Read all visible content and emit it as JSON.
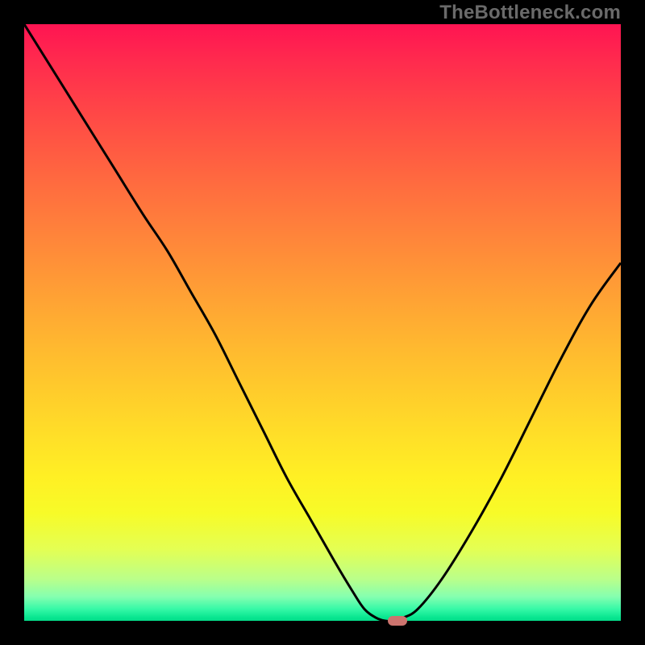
{
  "watermark": "TheBottleneck.com",
  "colors": {
    "frame": "#000000",
    "curve": "#000000",
    "marker": "#cc746e",
    "gradient_top": "#ff1452",
    "gradient_bottom": "#05dc89"
  },
  "chart_data": {
    "type": "line",
    "title": "",
    "xlabel": "",
    "ylabel": "",
    "xlim": [
      0,
      100
    ],
    "ylim": [
      0,
      100
    ],
    "x": [
      0,
      5,
      10,
      15,
      20,
      24,
      28,
      32,
      36,
      40,
      44,
      48,
      52,
      55,
      57,
      59,
      60.5,
      62,
      63.5,
      66,
      70,
      75,
      80,
      85,
      90,
      95,
      100
    ],
    "values": [
      100,
      92,
      84,
      76,
      68,
      62,
      55,
      48,
      40,
      32,
      24,
      17,
      10,
      5,
      2,
      0.5,
      0,
      0,
      0.5,
      2,
      7,
      15,
      24,
      34,
      44,
      53,
      60
    ],
    "marker": {
      "x": 62.5,
      "y": 0
    },
    "gradient_stops": [
      {
        "p": 0,
        "c": "#ff1452"
      },
      {
        "p": 6,
        "c": "#ff2a4e"
      },
      {
        "p": 13,
        "c": "#ff4148"
      },
      {
        "p": 20,
        "c": "#ff5743"
      },
      {
        "p": 27,
        "c": "#ff6c3f"
      },
      {
        "p": 34,
        "c": "#ff803b"
      },
      {
        "p": 41,
        "c": "#ff9437"
      },
      {
        "p": 48,
        "c": "#ffa833"
      },
      {
        "p": 55,
        "c": "#ffbb2f"
      },
      {
        "p": 62,
        "c": "#ffcd2b"
      },
      {
        "p": 69,
        "c": "#ffdf28"
      },
      {
        "p": 76,
        "c": "#fff024"
      },
      {
        "p": 82,
        "c": "#f7fb28"
      },
      {
        "p": 88,
        "c": "#e4ff53"
      },
      {
        "p": 93,
        "c": "#baff8a"
      },
      {
        "p": 96,
        "c": "#84ffb0"
      },
      {
        "p": 98,
        "c": "#37f9a7"
      },
      {
        "p": 99.5,
        "c": "#07e58f"
      },
      {
        "p": 100,
        "c": "#05dc89"
      }
    ]
  }
}
